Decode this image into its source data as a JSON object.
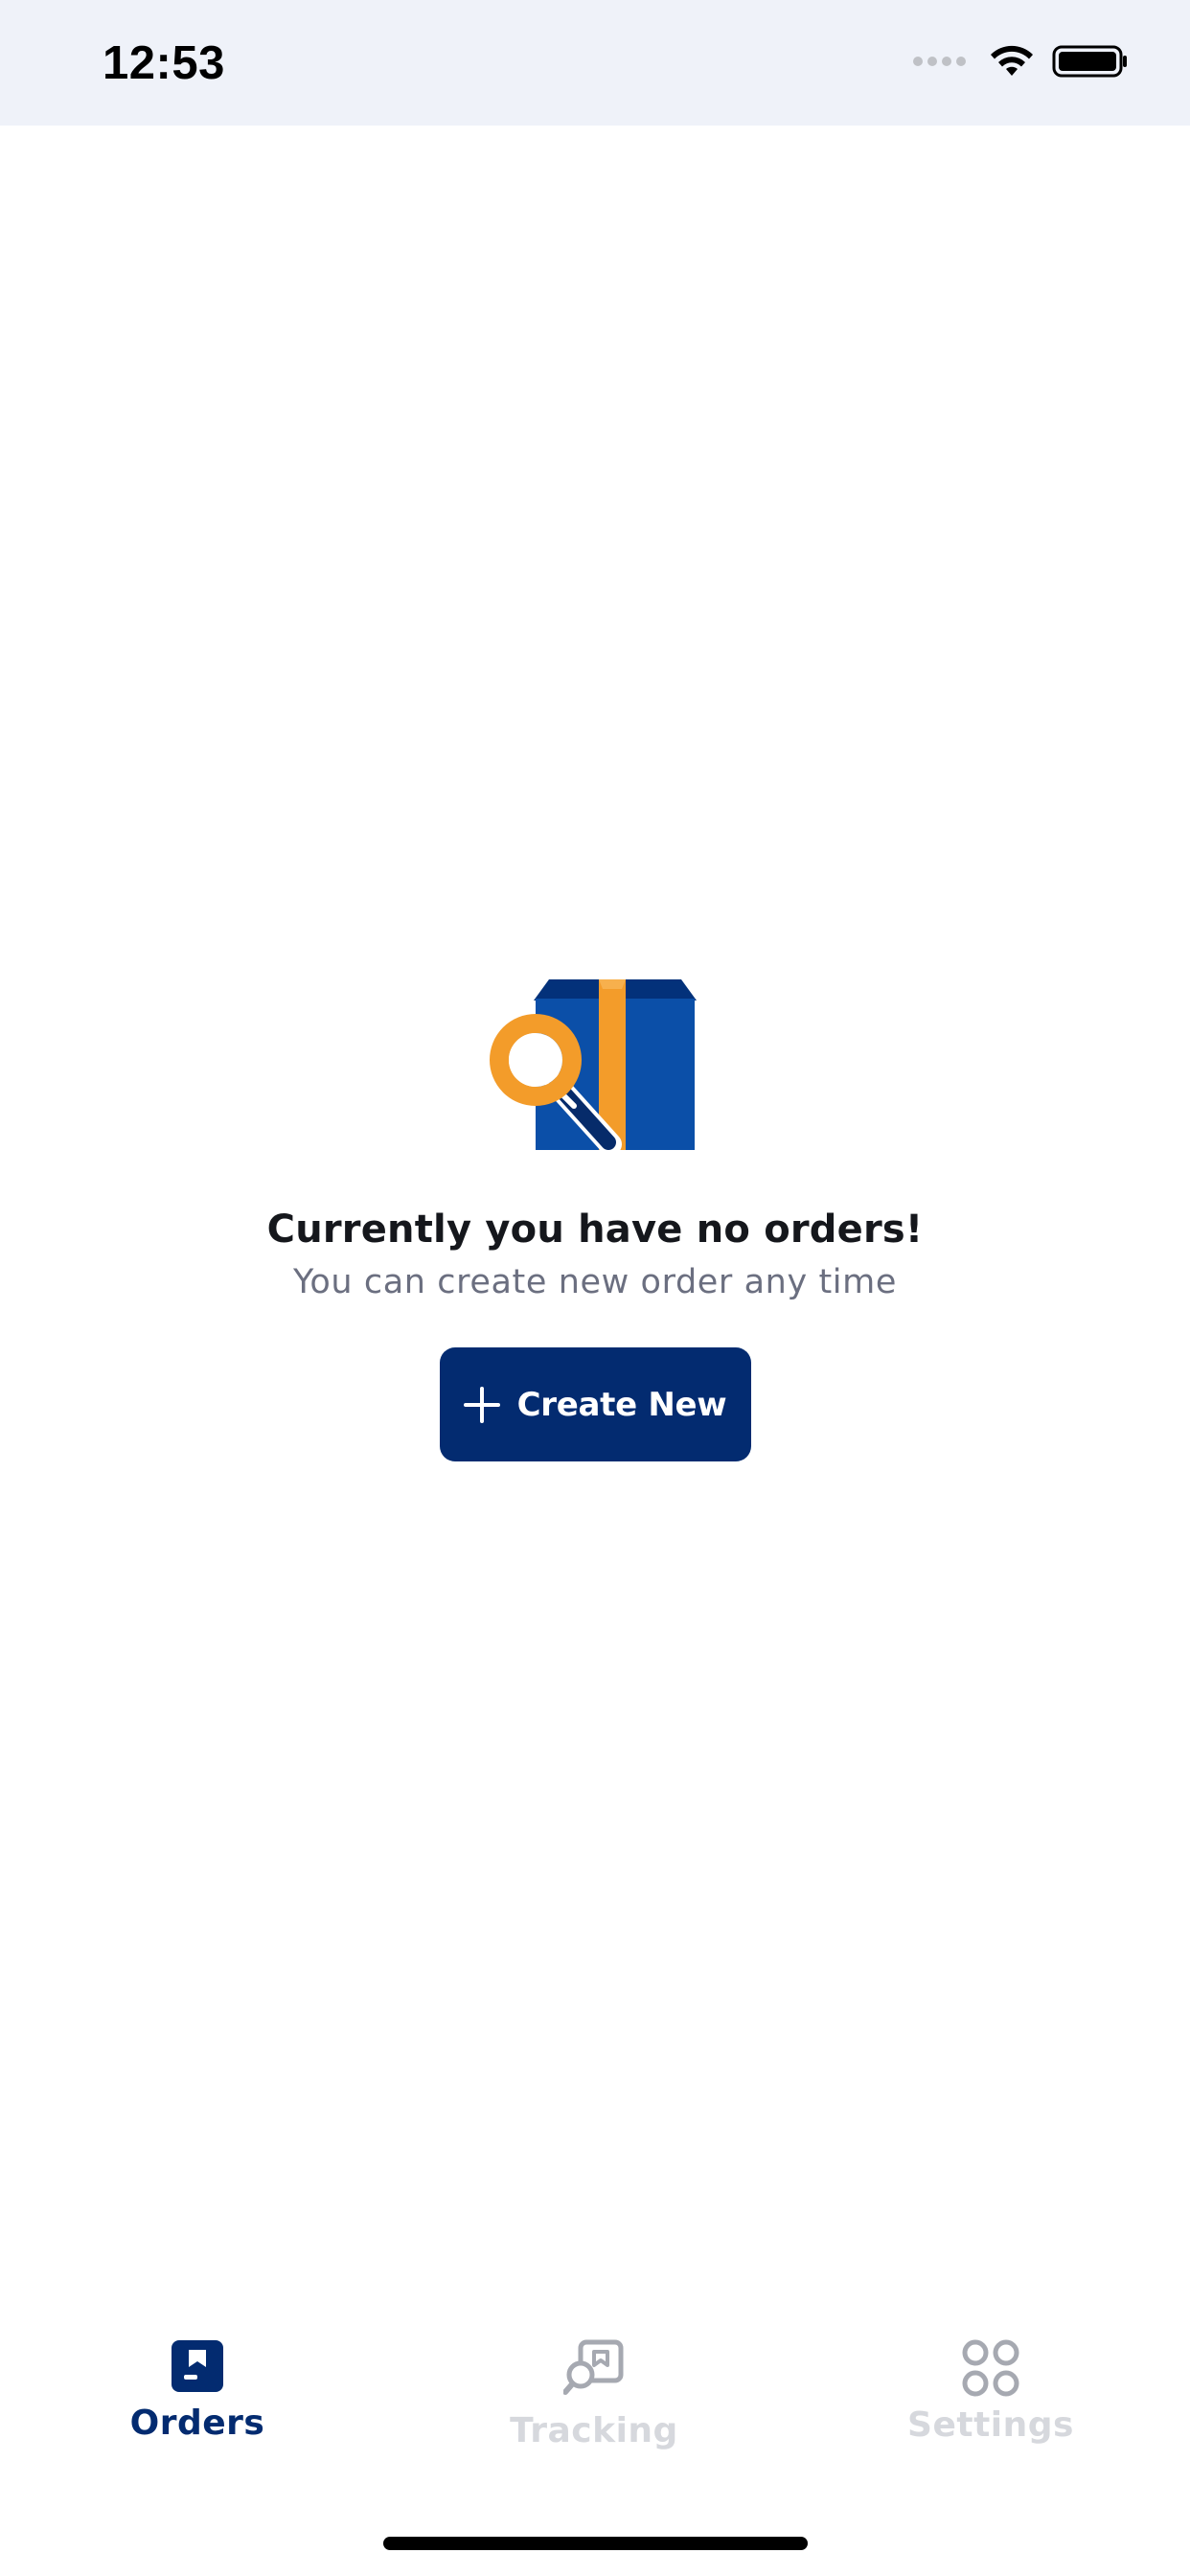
{
  "status_bar": {
    "time": "12:53",
    "icons": [
      "cellular-signal-icon",
      "wifi-icon",
      "battery-icon"
    ]
  },
  "empty_state": {
    "illustration": "package-search-icon",
    "title": "Currently you have no orders!",
    "subtitle": "You can create new order any time",
    "button_label": "Create New",
    "button_icon": "plus-icon"
  },
  "tab_bar": {
    "items": [
      {
        "label": "Orders",
        "icon": "orders-icon",
        "active": true
      },
      {
        "label": "Tracking",
        "icon": "tracking-icon",
        "active": false
      },
      {
        "label": "Settings",
        "icon": "settings-icon",
        "active": false
      }
    ]
  },
  "colors": {
    "brand_primary": "#032b70",
    "box_blue": "#0b4fa8",
    "accent_orange": "#f39c2a",
    "status_bar_bg": "#eff2f9",
    "inactive_tab": "#d6d8dd",
    "subtitle_gray": "#6b6f80"
  }
}
